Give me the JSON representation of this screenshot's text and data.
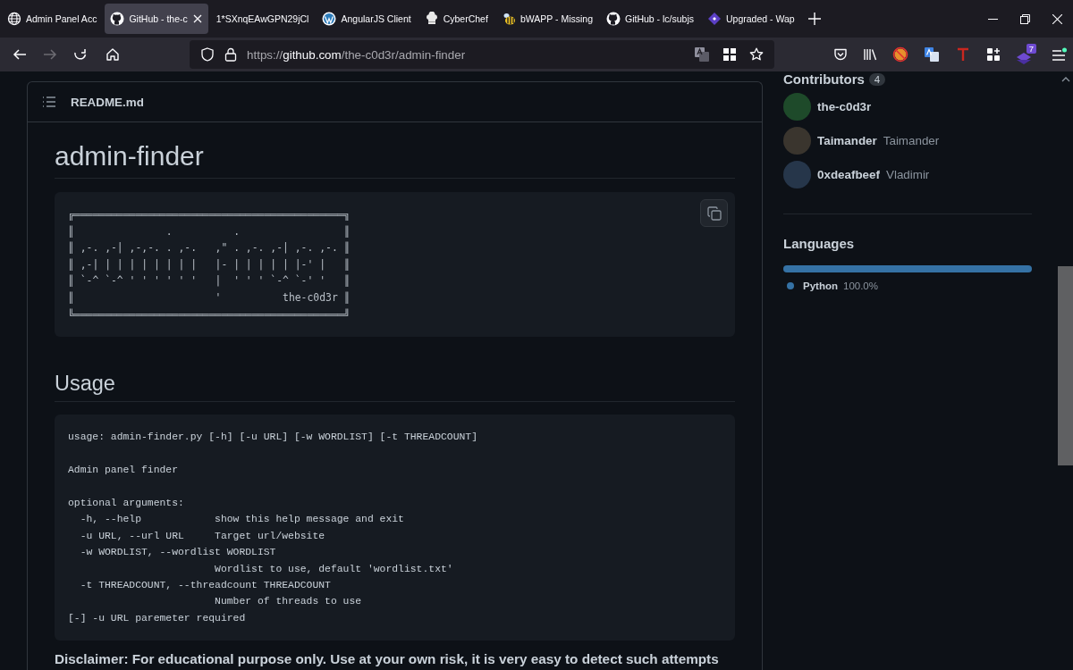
{
  "browser": {
    "tabs": [
      {
        "label": "Admin Panel Acc",
        "kind": "globe",
        "selected": false
      },
      {
        "label": "GitHub - the-c",
        "kind": "github",
        "selected": true
      },
      {
        "label": "1*SXnqEAwGPN29jCl",
        "kind": "none",
        "selected": false
      },
      {
        "label": "AngularJS Client",
        "kind": "wordpress",
        "selected": false
      },
      {
        "label": "CyberChef",
        "kind": "chef",
        "selected": false
      },
      {
        "label": "bWAPP - Missing",
        "kind": "bee",
        "selected": false
      },
      {
        "label": "GitHub - lc/subjs",
        "kind": "github",
        "selected": false
      },
      {
        "label": "Upgraded - Wap",
        "kind": "diamond",
        "selected": false
      }
    ],
    "nav_buttons": [
      {
        "kind": "back",
        "disabled": false
      },
      {
        "kind": "forward",
        "disabled": true
      },
      {
        "kind": "reload",
        "disabled": false
      },
      {
        "kind": "home",
        "disabled": false
      }
    ],
    "url_parts": [
      "https://",
      "github.com",
      "/the-c0d3r/admin-finder"
    ],
    "extension_badge": "7"
  },
  "readme": {
    "file_name": "README.md",
    "title": "admin-finder",
    "banner_lines": [
      "╔════════════════════════════════════════════╗",
      "║               .          .                 ║",
      "║ ,-. ,-| ,-,-. . ,-.   ,\" . ,-. ,-| ,-. ,-. ║",
      "║ ,-| | | | | | | | |   |- | | | | | |-' |   ║",
      "║ `-^ `-^ ' ' ' ' ' '   |  ' ' ' `-^ `-' '   ║",
      "║                       '          the-c0d3r ║",
      "╚════════════════════════════════════════════╝"
    ],
    "usage_heading": "Usage",
    "usage_paragraphs": [
      [
        "usage: admin-finder.py [-h] [-u URL] [-w WORDLIST] [-t THREADCOUNT]"
      ],
      [
        "Admin panel finder"
      ],
      [
        "optional arguments:",
        "  -h, --help            show this help message and exit",
        "  -u URL, --url URL     Target url/website",
        "  -w WORDLIST, --wordlist WORDLIST",
        "                        Wordlist to use, default 'wordlist.txt'",
        "  -t THREADCOUNT, --threadcount THREADCOUNT",
        "                        Number of threads to use",
        "[-] -u URL paremeter required"
      ]
    ],
    "disclaimer": "Disclaimer: For educational purpose only. Use at your own risk, it is very easy to detect such attempts"
  },
  "sidebar": {
    "contributors_title": "Contributors",
    "contributors_count": "4",
    "contributors": [
      {
        "login": "the-c0d3r"
      },
      {
        "login": "Taimander",
        "name": "Taimander"
      },
      {
        "login": "0xdeafbeef",
        "name": "Vladimir"
      }
    ],
    "languages_title": "Languages",
    "languages": [
      {
        "name": "Python",
        "percent": "100.0%",
        "color": "#3572a5",
        "level": 1
      }
    ]
  }
}
